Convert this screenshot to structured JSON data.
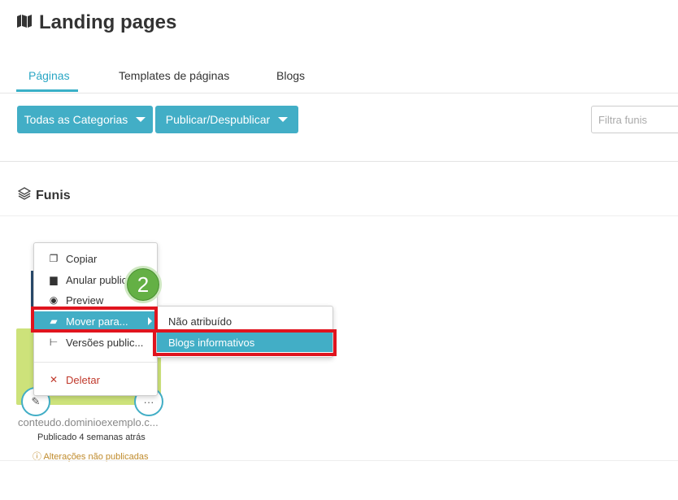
{
  "header": {
    "title": "Landing pages",
    "icon": "map-icon"
  },
  "tabs": [
    {
      "label": "Páginas",
      "active": true
    },
    {
      "label": "Templates de páginas",
      "active": false
    },
    {
      "label": "Blogs",
      "active": false
    }
  ],
  "toolbar": {
    "categories_label": "Todas as Categorias",
    "publish_label": "Publicar/Despublicar",
    "filter_placeholder": "Filtra funis"
  },
  "section": {
    "title": "Funis",
    "icon": "layers-icon"
  },
  "card": {
    "url": "conteudo.dominioexemplo.c...",
    "published": "Publicado 4 semanas atrás",
    "warning": "Alterações não publicadas",
    "edit_icon": "pencil-icon",
    "more_icon": "ellipsis-icon"
  },
  "context_menu": {
    "items": [
      {
        "label": "Copiar",
        "icon": "copy-icon"
      },
      {
        "label": "Anular publica",
        "icon": "unpublish-icon"
      },
      {
        "label": "Preview",
        "icon": "eye-icon"
      },
      {
        "label": "Mover para...",
        "icon": "folder-icon",
        "selected": true
      },
      {
        "label": "Versões public...",
        "icon": "versions-icon"
      },
      {
        "label": "Deletar",
        "icon": "x-icon"
      }
    ]
  },
  "submenu": {
    "items": [
      {
        "label": "Não atribuído"
      },
      {
        "label": "Blogs informativos",
        "selected": true
      }
    ]
  },
  "step_badge": "2",
  "colors": {
    "accent": "#42aec6",
    "highlight": "#e0141e",
    "badge": "#64b045",
    "card": "#cde27a",
    "danger": "#c0392b"
  }
}
